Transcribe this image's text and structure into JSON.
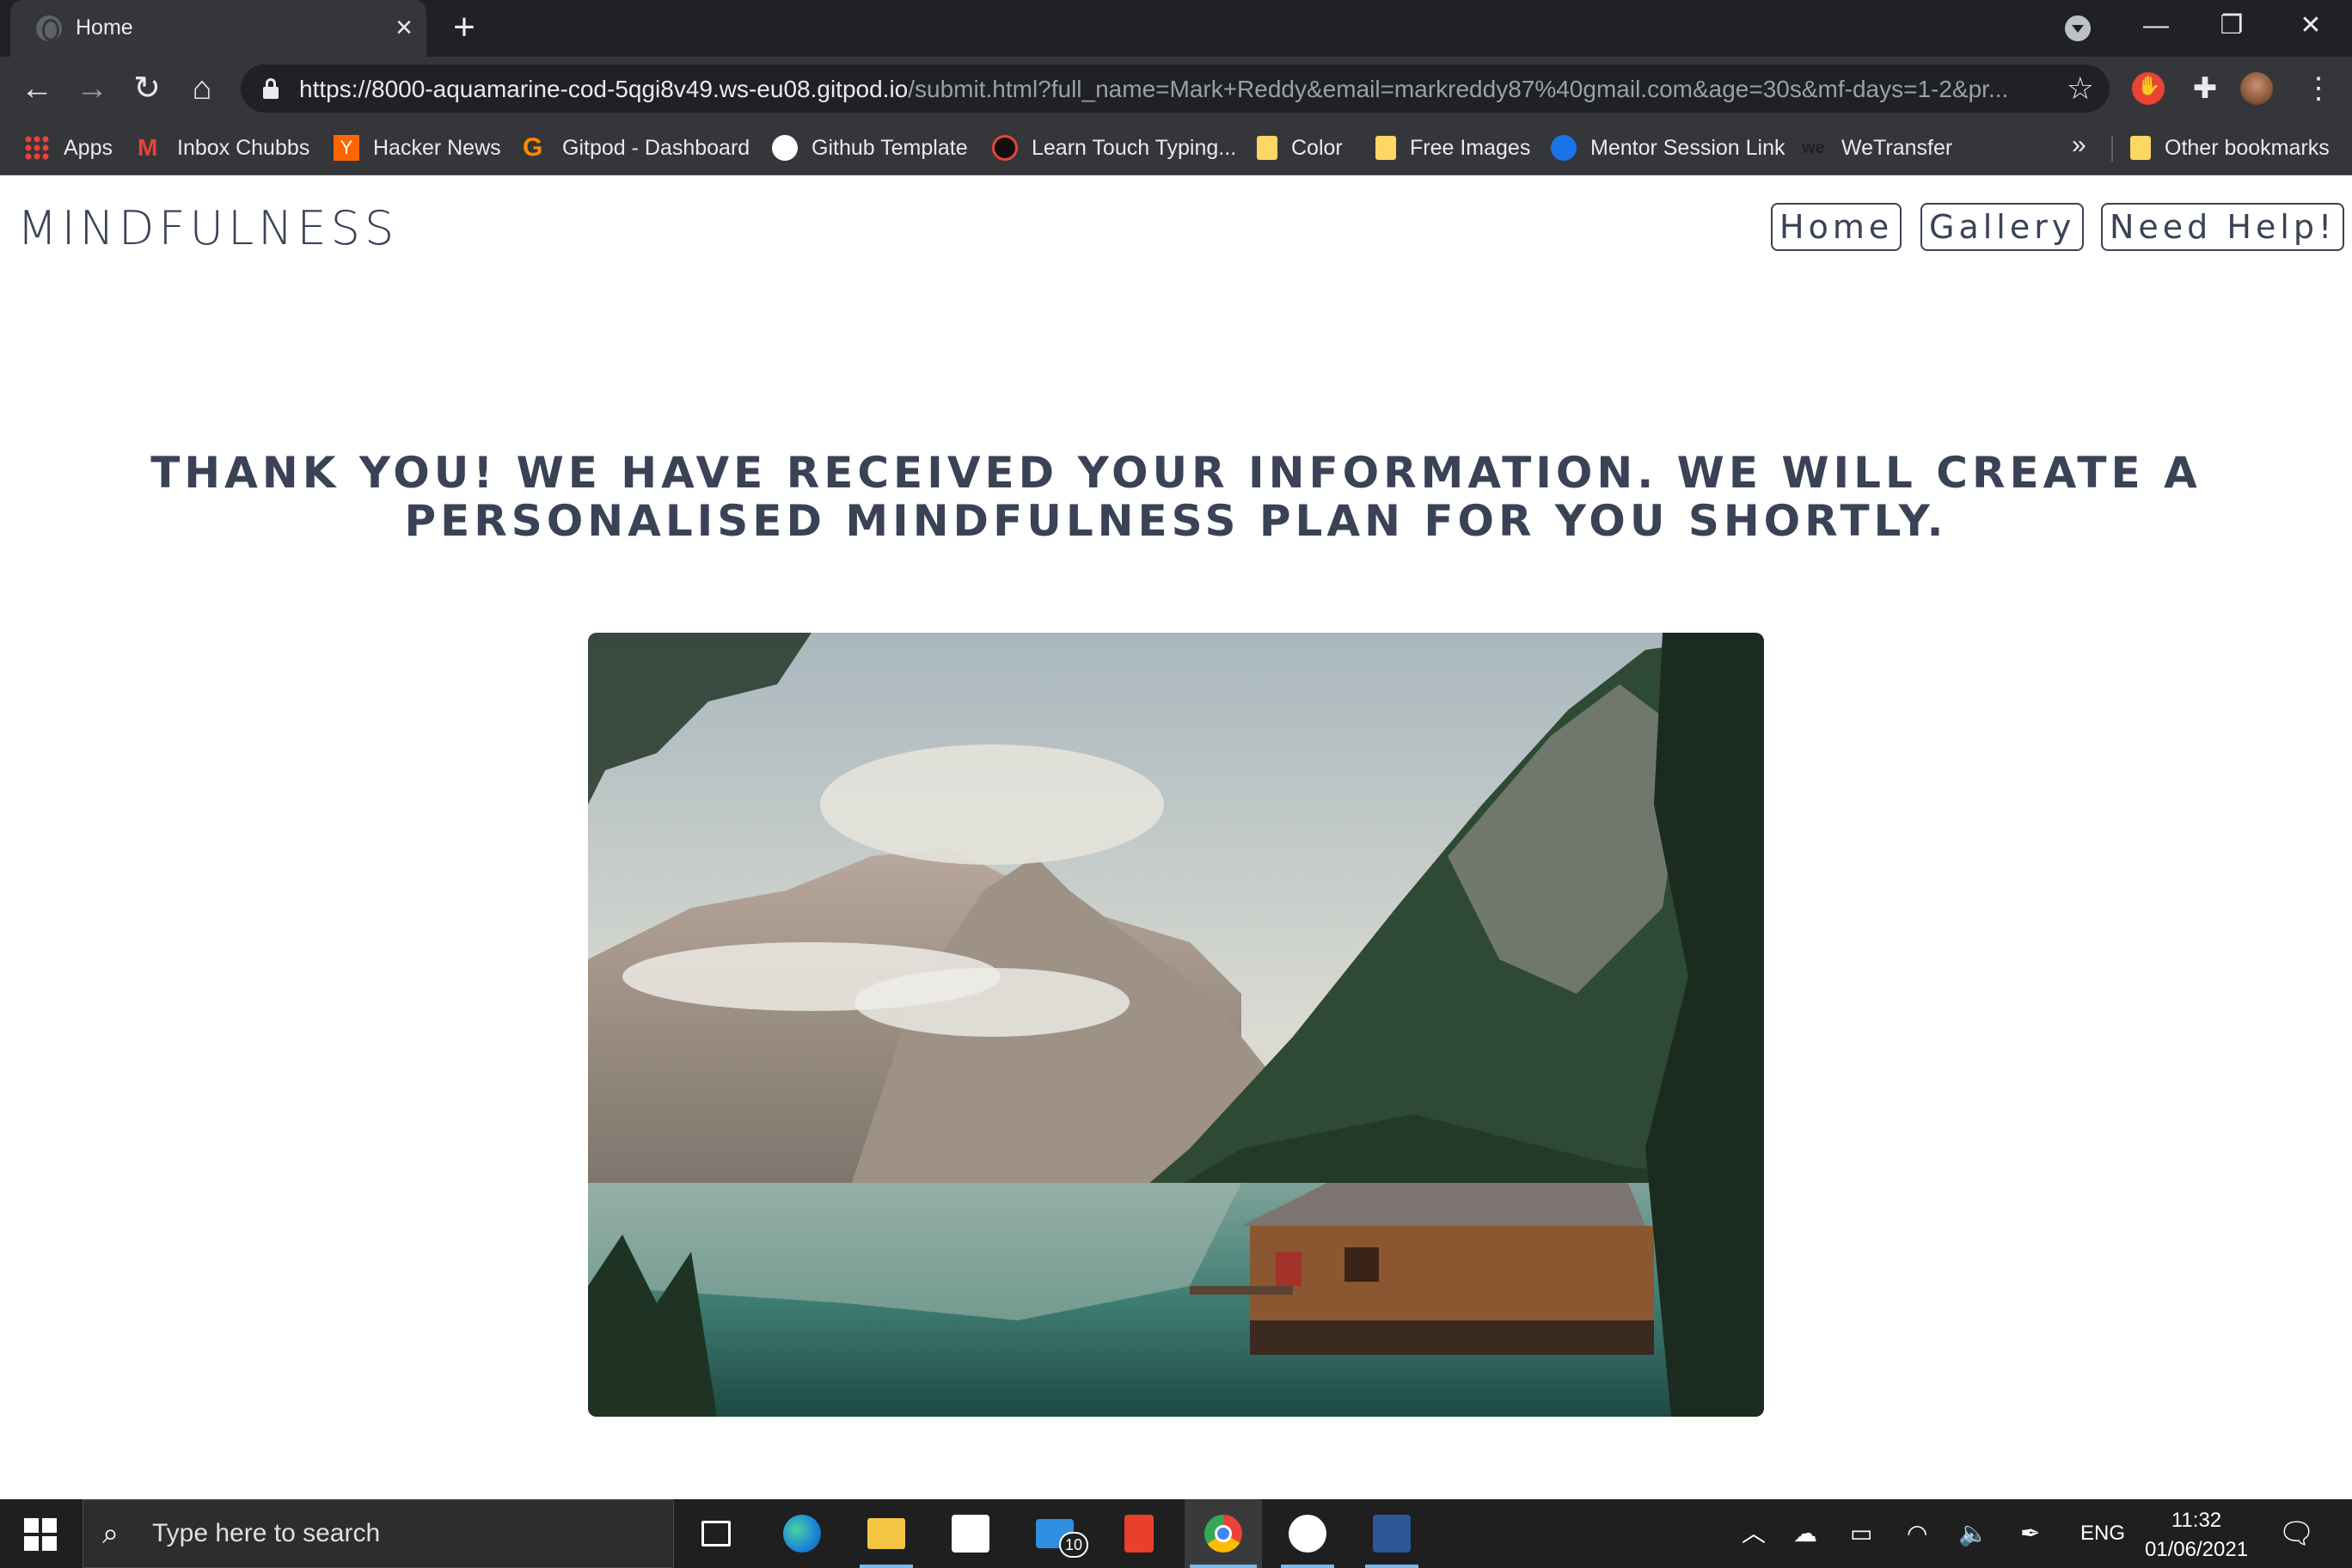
{
  "browser": {
    "tab_title": "Home",
    "url_host": "https://8000-aquamarine-cod-5qgi8v49.ws-eu08.gitpod.io",
    "url_path": "/submit.html?full_name=Mark+Reddy&email=markreddy87%40gmail.com&age=30s&mf-days=1-2&pr...",
    "bookmarks": [
      "Apps",
      "Inbox Chubbs",
      "Hacker News",
      "Gitpod - Dashboard",
      "Github Template",
      "Learn Touch Typing...",
      "Color",
      "Free Images",
      "Mentor Session Link",
      "WeTransfer"
    ],
    "other_bookmarks": "Other bookmarks",
    "overflow": "»"
  },
  "site": {
    "logo": "MINDFULNESS",
    "nav": [
      "Home",
      "Gallery",
      "Need Help!"
    ],
    "thanks_message": "Thank you! We have received your information. We will create a personalised mindfulness plan for you shortly."
  },
  "taskbar": {
    "search_placeholder": "Type here to search",
    "mail_badge": "10",
    "language": "ENG",
    "time": "11:32",
    "date": "01/06/2021"
  }
}
